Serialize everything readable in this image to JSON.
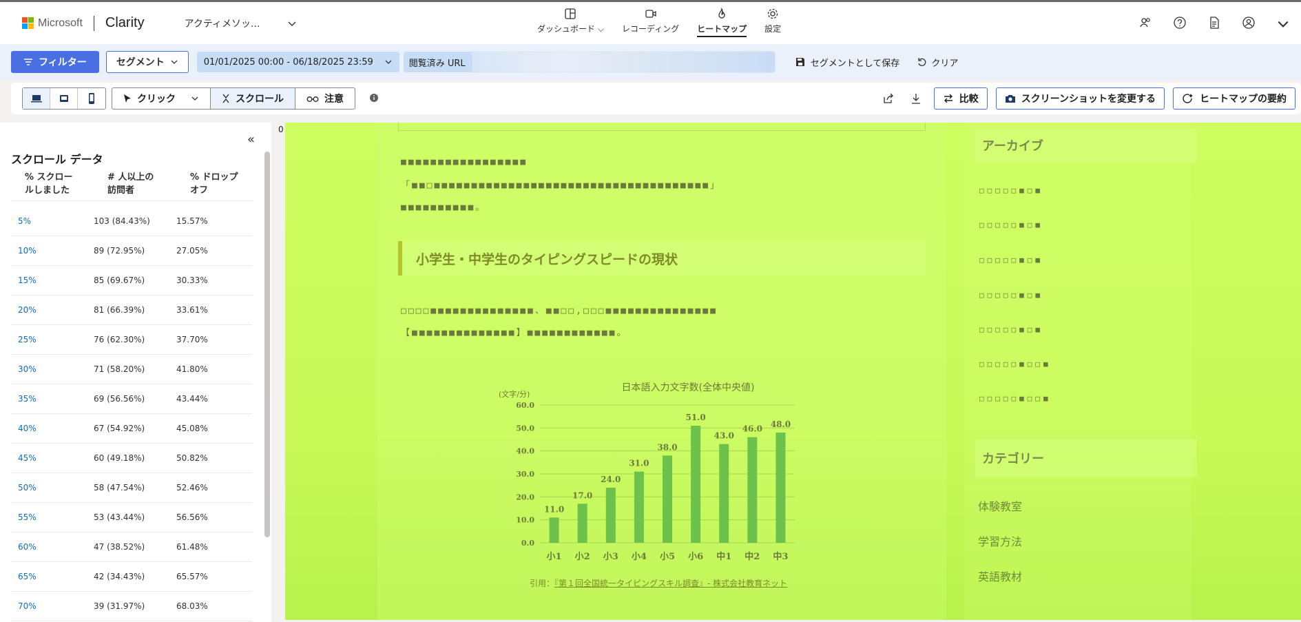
{
  "header": {
    "brand_company": "Microsoft",
    "brand_app": "Clarity",
    "project_name": "アクティメソッ...",
    "nav": [
      {
        "label": "ダッシュボード",
        "icon": "dashboard-icon",
        "has_chevron": true
      },
      {
        "label": "レコーディング",
        "icon": "video-icon"
      },
      {
        "label": "ヒートマップ",
        "icon": "flame-icon",
        "active": true
      },
      {
        "label": "設定",
        "icon": "gear-icon"
      }
    ],
    "right_icons": [
      "team-icon",
      "help-icon",
      "document-icon",
      "account-icon"
    ]
  },
  "filterbar": {
    "filter_label": "フィルター",
    "segment_label": "セグメント",
    "date_range": "01/01/2025 00:00 - 06/18/2025 23:59",
    "url_label": "閲覧済み URL",
    "save_segment_label": "セグメントとして保存",
    "clear_label": "クリア"
  },
  "toolbar": {
    "devices": [
      "desktop-icon",
      "tablet-icon",
      "mobile-icon"
    ],
    "modes": [
      {
        "label": "クリック",
        "icon": "cursor-icon",
        "dropdown": true
      },
      {
        "label": "スクロール",
        "icon": "scroll-icon",
        "active": true
      },
      {
        "label": "注意",
        "icon": "glasses-icon"
      }
    ],
    "compare_label": "比較",
    "change_screenshot_label": "スクリーンショットを変更する",
    "summary_label": "ヒートマップの要約"
  },
  "sidebar": {
    "title": "スクロール データ",
    "col1_line1": "% スクロー",
    "col1_line2": "ルしました",
    "col2_line1": "# 人以上の",
    "col2_line2": "訪問者",
    "col3_line1": "% ドロップ",
    "col3_line2": "オフ",
    "rows": [
      {
        "pct": "5%",
        "visitors": "103 (84.43%)",
        "dropoff": "15.57%"
      },
      {
        "pct": "10%",
        "visitors": "89 (72.95%)",
        "dropoff": "27.05%"
      },
      {
        "pct": "15%",
        "visitors": "85 (69.67%)",
        "dropoff": "30.33%"
      },
      {
        "pct": "20%",
        "visitors": "81 (66.39%)",
        "dropoff": "33.61%"
      },
      {
        "pct": "25%",
        "visitors": "76 (62.30%)",
        "dropoff": "37.70%"
      },
      {
        "pct": "30%",
        "visitors": "71 (58.20%)",
        "dropoff": "41.80%"
      },
      {
        "pct": "35%",
        "visitors": "69 (56.56%)",
        "dropoff": "43.44%"
      },
      {
        "pct": "40%",
        "visitors": "67 (54.92%)",
        "dropoff": "45.08%"
      },
      {
        "pct": "45%",
        "visitors": "60 (49.18%)",
        "dropoff": "50.82%"
      },
      {
        "pct": "50%",
        "visitors": "58 (47.54%)",
        "dropoff": "52.46%"
      },
      {
        "pct": "55%",
        "visitors": "53 (43.44%)",
        "dropoff": "56.56%"
      },
      {
        "pct": "60%",
        "visitors": "47 (38.52%)",
        "dropoff": "61.48%"
      },
      {
        "pct": "65%",
        "visitors": "42 (34.43%)",
        "dropoff": "65.57%"
      },
      {
        "pct": "70%",
        "visitors": "39 (31.97%)",
        "dropoff": "68.03%"
      }
    ]
  },
  "canvas": {
    "zero_marker": "0",
    "article_heading": "小学生・中学生のタイピングスピードの現状",
    "citation_prefix": "引用：",
    "citation_link": "『第１回全国統一タイピングスキル調査』- 株式会社教育ネット",
    "archive_heading": "アーカイブ",
    "category_heading": "カテゴリー",
    "categories": [
      "体験教室",
      "学習方法",
      "英語教材"
    ],
    "heatmap_color": "#cafa58"
  },
  "chart_data": {
    "type": "bar",
    "title": "日本語入力文字数(全体中央値)",
    "ylabel": "(文字/分)",
    "categories": [
      "小1",
      "小2",
      "小3",
      "小4",
      "小5",
      "小6",
      "中1",
      "中2",
      "中3"
    ],
    "values": [
      11.0,
      17.0,
      24.0,
      31.0,
      38.0,
      51.0,
      43.0,
      46.0,
      48.0
    ],
    "ylim": [
      0,
      60
    ],
    "yticks": [
      "0.0",
      "10.0",
      "20.0",
      "30.0",
      "40.0",
      "50.0",
      "60.0"
    ],
    "value_labels": [
      "11.0",
      "17.0",
      "24.0",
      "31.0",
      "38.0",
      "51.0",
      "43.0",
      "46.0",
      "48.0"
    ],
    "bar_color": "#6cc24a",
    "grid": true
  }
}
